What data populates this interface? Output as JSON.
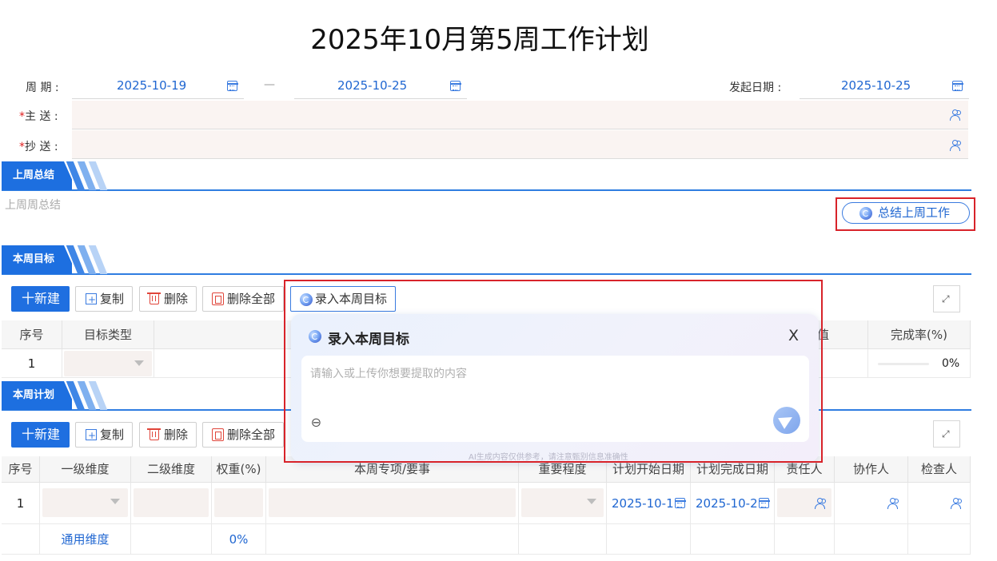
{
  "page_title": "2025年10月第5周工作计划",
  "header": {
    "period_label": "周 期 :",
    "period_start": "2025-10-19",
    "period_sep": "—",
    "period_end": "2025-10-25",
    "start_date_label": "发起日期 :",
    "start_date": "2025-10-25",
    "to_required_mark": "*",
    "to_label": "主 送 :",
    "cc_required_mark": "*",
    "cc_label": "抄 送 :"
  },
  "last_week": {
    "section_title": "上周总结",
    "placeholder": "上周周总结",
    "summarize_button": "总结上周工作"
  },
  "goals": {
    "section_title": "本周目标",
    "toolbar": {
      "new": "十新建",
      "copy": "复制",
      "delete": "删除",
      "delete_all": "删除全部",
      "ai_input": "录入本周目标"
    },
    "columns": [
      "序号",
      "目标类型",
      "值",
      "完成率(%)"
    ],
    "rows": [
      {
        "index": "1",
        "rate": "0%"
      }
    ]
  },
  "ai_popup": {
    "title": "录入本周目标",
    "close": "X",
    "placeholder": "请输入或上传你想要提取的内容",
    "disclaimer": "AI生成内容仅供参考，请注意甄别信息准确性"
  },
  "plans": {
    "section_title": "本周计划",
    "toolbar": {
      "new": "十新建",
      "copy": "复制",
      "delete": "删除",
      "delete_all": "删除全部"
    },
    "columns": [
      "序号",
      "一级维度",
      "二级维度",
      "权重(%)",
      "本周专项/要事",
      "重要程度",
      "计划开始日期",
      "计划完成日期",
      "责任人",
      "协作人",
      "检查人"
    ],
    "rows": [
      {
        "index": "1",
        "start": "2025-10-1",
        "end": "2025-10-2"
      }
    ],
    "footer": {
      "label": "通用维度",
      "weight": "0%"
    }
  },
  "colors": {
    "accent": "#1f6fe0",
    "highlight_border": "#d8232a",
    "required": "#e02020"
  }
}
